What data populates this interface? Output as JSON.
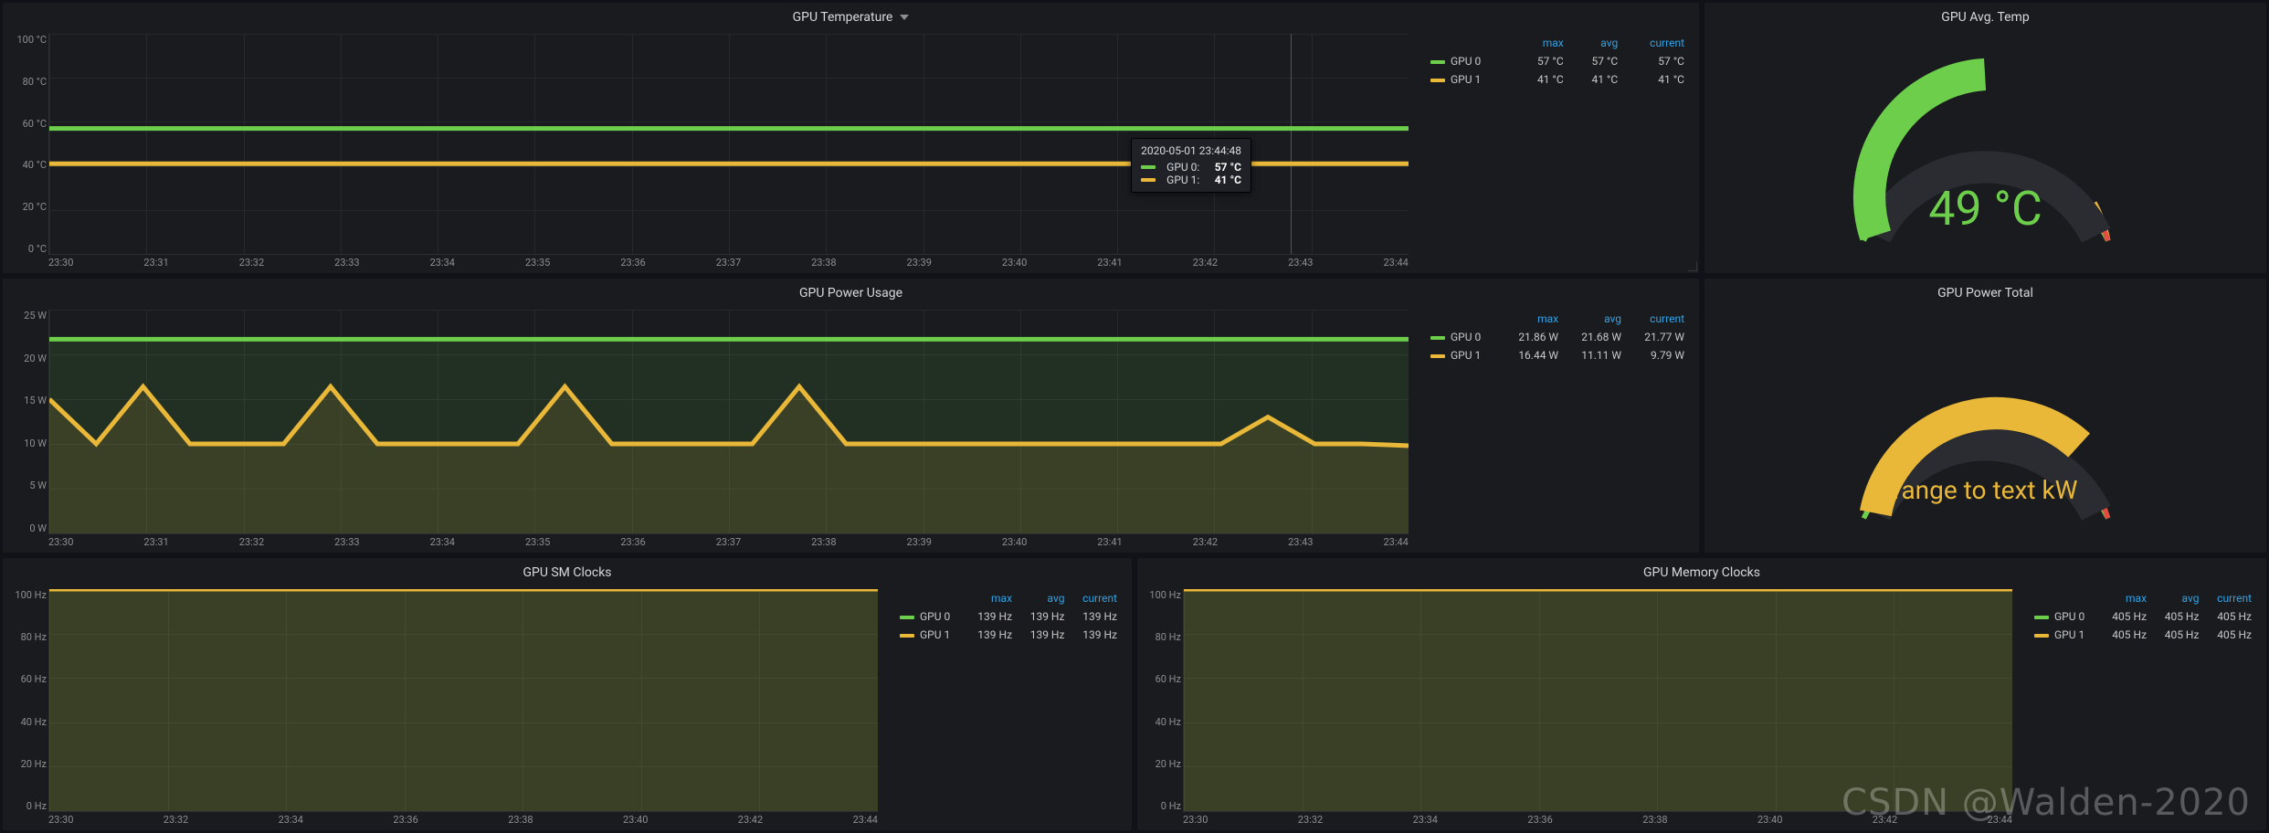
{
  "colors": {
    "gpu0": "#6cce4a",
    "gpu1": "#eab839",
    "grid": "#26282d"
  },
  "watermark": "CSDN @Walden-2020",
  "panels": {
    "gpu_temp": {
      "title": "GPU Temperature",
      "title_has_caret": true,
      "y_ticks": [
        "100 °C",
        "80 °C",
        "60 °C",
        "40 °C",
        "20 °C",
        "0 °C"
      ],
      "x_ticks": [
        "23:30",
        "23:31",
        "23:32",
        "23:33",
        "23:34",
        "23:35",
        "23:36",
        "23:37",
        "23:38",
        "23:39",
        "23:40",
        "23:41",
        "23:42",
        "23:43",
        "23:44"
      ],
      "legend_headers": [
        "max",
        "avg",
        "current"
      ],
      "legend": [
        {
          "name": "GPU 0",
          "color": "gpu0",
          "max": "57 °C",
          "avg": "57 °C",
          "current": "57 °C"
        },
        {
          "name": "GPU 1",
          "color": "gpu1",
          "max": "41 °C",
          "avg": "41 °C",
          "current": "41 °C"
        }
      ],
      "tooltip": {
        "date": "2020-05-01 23:44:48",
        "rows": [
          {
            "name": "GPU 0:",
            "color": "gpu0",
            "val": "57 °C"
          },
          {
            "name": "GPU 1:",
            "color": "gpu1",
            "val": "41 °C"
          }
        ],
        "cursor_x_pct": 91.3
      }
    },
    "gpu_avg_temp": {
      "title": "GPU Avg. Temp",
      "value": "49 °C",
      "value_color": "gpu0"
    },
    "gpu_power_usage": {
      "title": "GPU Power Usage",
      "y_ticks": [
        "25 W",
        "20 W",
        "15 W",
        "10 W",
        "5 W",
        "0 W"
      ],
      "x_ticks": [
        "23:30",
        "23:31",
        "23:32",
        "23:33",
        "23:34",
        "23:35",
        "23:36",
        "23:37",
        "23:38",
        "23:39",
        "23:40",
        "23:41",
        "23:42",
        "23:43",
        "23:44"
      ],
      "legend_headers": [
        "max",
        "avg",
        "current"
      ],
      "legend": [
        {
          "name": "GPU 0",
          "color": "gpu0",
          "max": "21.86 W",
          "avg": "21.68 W",
          "current": "21.77 W"
        },
        {
          "name": "GPU 1",
          "color": "gpu1",
          "max": "16.44 W",
          "avg": "11.11 W",
          "current": "9.79 W"
        }
      ]
    },
    "gpu_power_total": {
      "title": "GPU Power Total",
      "value": "range to text kW",
      "value_color": "gpu1"
    },
    "gpu_sm_clocks": {
      "title": "GPU SM Clocks",
      "y_ticks": [
        "100 Hz",
        "80 Hz",
        "60 Hz",
        "40 Hz",
        "20 Hz",
        "0 Hz"
      ],
      "x_ticks": [
        "23:30",
        "23:32",
        "23:34",
        "23:36",
        "23:38",
        "23:40",
        "23:42",
        "23:44"
      ],
      "legend_headers": [
        "max",
        "avg",
        "current"
      ],
      "legend": [
        {
          "name": "GPU 0",
          "color": "gpu0",
          "max": "139 Hz",
          "avg": "139 Hz",
          "current": "139 Hz"
        },
        {
          "name": "GPU 1",
          "color": "gpu1",
          "max": "139 Hz",
          "avg": "139 Hz",
          "current": "139 Hz"
        }
      ]
    },
    "gpu_memory_clocks": {
      "title": "GPU Memory Clocks",
      "y_ticks": [
        "100 Hz",
        "80 Hz",
        "60 Hz",
        "40 Hz",
        "20 Hz",
        "0 Hz"
      ],
      "x_ticks": [
        "23:30",
        "23:32",
        "23:34",
        "23:36",
        "23:38",
        "23:40",
        "23:42",
        "23:44"
      ],
      "legend_headers": [
        "max",
        "avg",
        "current"
      ],
      "legend": [
        {
          "name": "GPU 0",
          "color": "gpu0",
          "max": "405 Hz",
          "avg": "405 Hz",
          "current": "405 Hz"
        },
        {
          "name": "GPU 1",
          "color": "gpu1",
          "max": "405 Hz",
          "avg": "405 Hz",
          "current": "405 Hz"
        }
      ]
    }
  },
  "chart_data": [
    {
      "panel": "gpu_temp",
      "type": "line",
      "ylim": [
        0,
        100
      ],
      "yunit": "°C",
      "x": [
        "23:30",
        "23:31",
        "23:32",
        "23:33",
        "23:34",
        "23:35",
        "23:36",
        "23:37",
        "23:38",
        "23:39",
        "23:40",
        "23:41",
        "23:42",
        "23:43",
        "23:44"
      ],
      "series": [
        {
          "name": "GPU 0",
          "color": "gpu0",
          "values": [
            57,
            57,
            57,
            57,
            57,
            57,
            57,
            57,
            57,
            57,
            57,
            57,
            57,
            57,
            57
          ]
        },
        {
          "name": "GPU 1",
          "color": "gpu1",
          "values": [
            41,
            41,
            41,
            41,
            41,
            41,
            41,
            41,
            41,
            41,
            41,
            41,
            41,
            41,
            41
          ]
        }
      ]
    },
    {
      "panel": "gpu_power_usage",
      "type": "area",
      "ylim": [
        0,
        25
      ],
      "yunit": "W",
      "x": [
        "23:30",
        "23:30.5",
        "23:31",
        "23:31.5",
        "23:32",
        "23:32.5",
        "23:33",
        "23:33.5",
        "23:34",
        "23:34.5",
        "23:35",
        "23:35.5",
        "23:36",
        "23:36.5",
        "23:37",
        "23:37.5",
        "23:38",
        "23:38.5",
        "23:39",
        "23:39.5",
        "23:40",
        "23:40.5",
        "23:41",
        "23:41.5",
        "23:42",
        "23:42.5",
        "23:43",
        "23:43.5",
        "23:44",
        "23:44.5"
      ],
      "series": [
        {
          "name": "GPU 0",
          "color": "gpu0",
          "values": [
            21.7,
            21.7,
            21.7,
            21.7,
            21.7,
            21.7,
            21.7,
            21.7,
            21.7,
            21.7,
            21.7,
            21.7,
            21.7,
            21.7,
            21.7,
            21.7,
            21.7,
            21.7,
            21.7,
            21.7,
            21.7,
            21.7,
            21.7,
            21.7,
            21.7,
            21.7,
            21.7,
            21.7,
            21.7,
            21.7
          ]
        },
        {
          "name": "GPU 1",
          "color": "gpu1",
          "values": [
            15,
            10,
            16.4,
            10,
            10,
            10,
            16.4,
            10,
            10,
            10,
            10,
            16.4,
            10,
            10,
            10,
            10,
            16.4,
            10,
            10,
            10,
            10,
            10,
            10,
            10,
            10,
            10,
            13,
            10,
            10,
            9.8
          ]
        }
      ]
    },
    {
      "panel": "gpu_sm_clocks",
      "type": "area",
      "ylim": [
        0,
        100
      ],
      "yunit": "Hz",
      "x": [
        "23:30",
        "23:32",
        "23:34",
        "23:36",
        "23:38",
        "23:40",
        "23:42",
        "23:44"
      ],
      "series": [
        {
          "name": "GPU 0",
          "color": "gpu0",
          "values": [
            139,
            139,
            139,
            139,
            139,
            139,
            139,
            139
          ]
        },
        {
          "name": "GPU 1",
          "color": "gpu1",
          "values": [
            139,
            139,
            139,
            139,
            139,
            139,
            139,
            139
          ]
        }
      ],
      "note": "values above ylim -> flat at top"
    },
    {
      "panel": "gpu_memory_clocks",
      "type": "area",
      "ylim": [
        0,
        100
      ],
      "yunit": "Hz",
      "x": [
        "23:30",
        "23:32",
        "23:34",
        "23:36",
        "23:38",
        "23:40",
        "23:42",
        "23:44"
      ],
      "series": [
        {
          "name": "GPU 0",
          "color": "gpu0",
          "values": [
            405,
            405,
            405,
            405,
            405,
            405,
            405,
            405
          ]
        },
        {
          "name": "GPU 1",
          "color": "gpu1",
          "values": [
            405,
            405,
            405,
            405,
            405,
            405,
            405,
            405
          ]
        }
      ],
      "note": "values above ylim -> flat at top"
    },
    {
      "panel": "gpu_avg_temp",
      "type": "gauge",
      "range": [
        0,
        100
      ],
      "thresholds": [
        70,
        85
      ],
      "colors": [
        "#6cce4a",
        "#eab839",
        "#e24d42"
      ],
      "value": 49,
      "unit": "°C"
    },
    {
      "panel": "gpu_power_total",
      "type": "gauge",
      "range": [
        0,
        100
      ],
      "thresholds": [
        85,
        95
      ],
      "colors": [
        "#eab839",
        "#eab839",
        "#e24d42"
      ],
      "value": 75,
      "unit": "kW",
      "display": "range to text kW"
    }
  ]
}
